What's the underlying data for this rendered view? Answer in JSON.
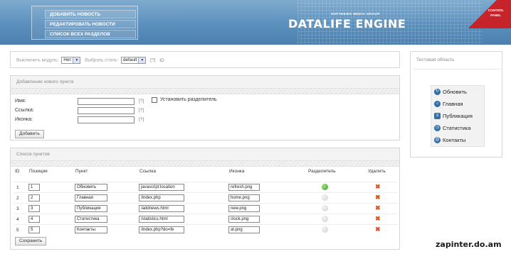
{
  "header": {
    "nav_items": [
      "Добавить новость",
      "Редактировать новости",
      "Список всех разделов"
    ],
    "brand": "DATALIFE ENGINE",
    "brand_sub": "SOFTNEWS MEDIA GROUP",
    "control_panel": [
      "CONTROL",
      "PANEL"
    ]
  },
  "toolbar": {
    "disable_label": "Выключить модуль:",
    "disable_value": "Нет",
    "style_label": "Выбрать стиль:",
    "style_value": "default",
    "help": "[?]",
    "id_label": "ID"
  },
  "add_panel": {
    "title": "Добавление нового пункта",
    "name_label": "Имя:",
    "link_label": "Ссылка:",
    "icon_label": "Иконка:",
    "help": "[?]",
    "separator_label": "Установить разделитель",
    "add_button": "Добавить"
  },
  "list_panel": {
    "title": "Список пунктов",
    "columns": [
      "ID",
      "Позиция",
      "Пункт",
      "Ссылка",
      "Иконка",
      "Разделитель",
      "Удалить"
    ],
    "rows": [
      {
        "id": "1",
        "position": "1",
        "item": "Обновить",
        "link": "javascript:location",
        "icon": "refresh.png",
        "separator": true
      },
      {
        "id": "2",
        "position": "2",
        "item": "Главная",
        "link": "/index.php",
        "icon": "home.png",
        "separator": false
      },
      {
        "id": "3",
        "position": "3",
        "item": "Публикация",
        "link": "/addnews.html",
        "icon": "new.png",
        "separator": false
      },
      {
        "id": "4",
        "position": "4",
        "item": "Статистика",
        "link": "/statistics.html",
        "icon": "clock.png",
        "separator": false
      },
      {
        "id": "5",
        "position": "5",
        "item": "Контакты",
        "link": "/index.php?do=fe",
        "icon": "at.png",
        "separator": false
      }
    ],
    "save_button": "Сохранить"
  },
  "test_area": {
    "title": "Тестовая область",
    "items": [
      "Обновить",
      "Главная",
      "Публикация",
      "Статистика",
      "Контакты"
    ]
  },
  "watermark": "zapinter.do.am",
  "colors": {
    "header": "#5b8fbc",
    "accent_red": "#c6242a",
    "ok": "#3aa12a",
    "delete": "#d9531e"
  }
}
